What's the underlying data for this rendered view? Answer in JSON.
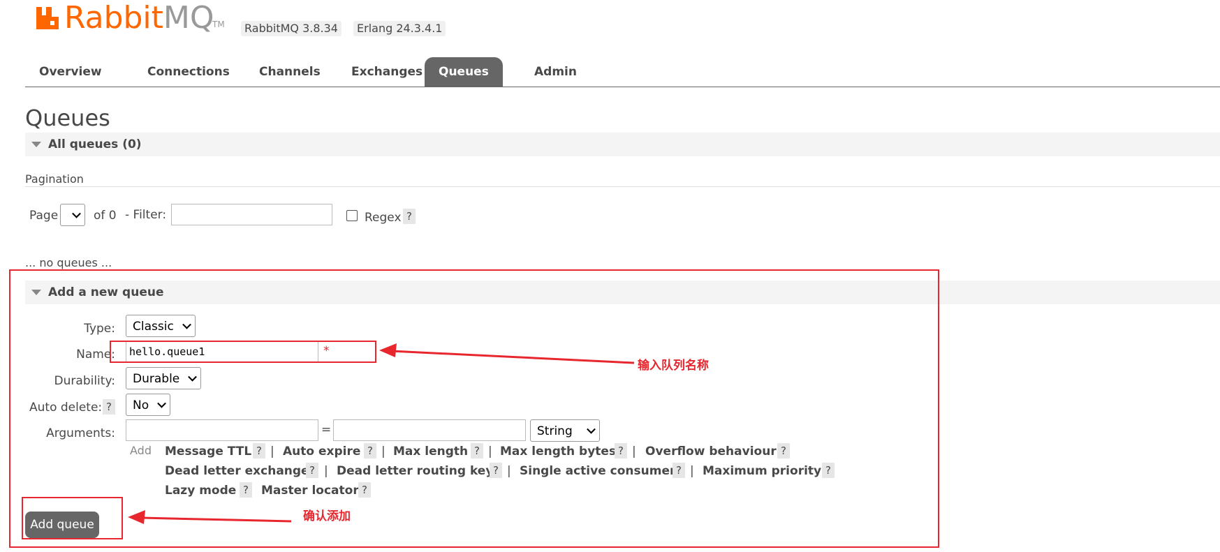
{
  "header": {
    "logo_text_rabbit": "Rabbit",
    "logo_text_mq": "MQ",
    "logo_tm": "TM",
    "rabbitmq_version": "RabbitMQ 3.8.34",
    "erlang_version": "Erlang 24.3.4.1"
  },
  "tabs": [
    {
      "label": "Overview"
    },
    {
      "label": "Connections"
    },
    {
      "label": "Channels"
    },
    {
      "label": "Exchanges"
    },
    {
      "label": "Queues",
      "active": true
    },
    {
      "label": "Admin"
    }
  ],
  "page_title": "Queues",
  "all_queues": {
    "label": "All queues (0)"
  },
  "pagination": {
    "label": "Pagination",
    "page_label": "Page",
    "of_label": "of 0",
    "filter_label": "- Filter:",
    "filter_value": "",
    "regex_label": "Regex",
    "help": "?"
  },
  "no_queues": "... no queues ...",
  "add_queue": {
    "section_label": "Add a new queue",
    "type_label": "Type:",
    "type_value": "Classic",
    "name_label": "Name:",
    "name_value": "hello.queue1",
    "required_mark": "*",
    "durability_label": "Durability:",
    "durability_value": "Durable",
    "auto_delete_label": "Auto delete:",
    "auto_delete_value": "No",
    "arguments_label": "Arguments:",
    "arguments_equals": "=",
    "arguments_type": "String",
    "add_label": "Add",
    "argument_links_row1": [
      "Message TTL",
      "Auto expire",
      "Max length",
      "Max length bytes",
      "Overflow behaviour"
    ],
    "argument_links_row2": [
      "Dead letter exchange",
      "Dead letter routing key",
      "Single active consumer",
      "Maximum priority"
    ],
    "argument_links_row3": [
      "Lazy mode",
      "Master locator"
    ],
    "separator": "|",
    "submit_label": "Add queue"
  },
  "annotations": {
    "name_hint": "输入队列名称",
    "submit_hint": "确认添加"
  },
  "colors": {
    "brand": "#ff6600",
    "tab_active_bg": "#666666",
    "annotation": "#e8262e"
  }
}
